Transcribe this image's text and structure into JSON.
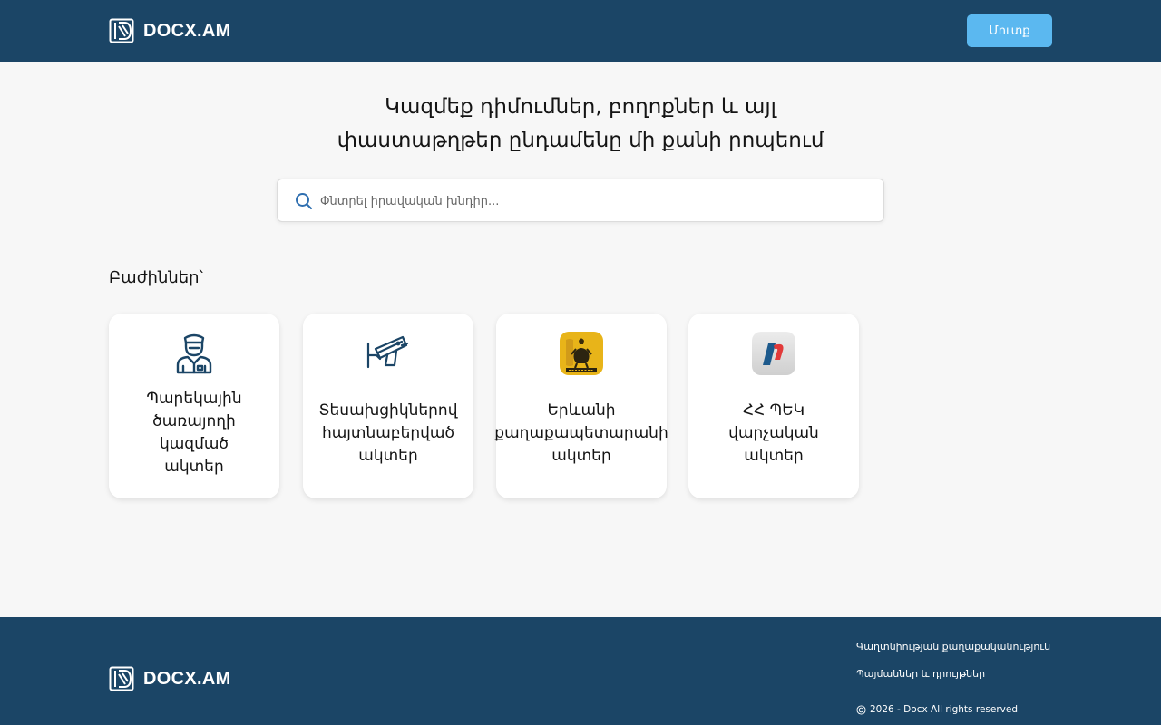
{
  "header": {
    "logo_text": "DOCX.AM",
    "login_label": "Մուտք"
  },
  "hero": {
    "title_line1": "Կազմեք դիմումներ, բողոքներ և այլ",
    "title_line2": "փաստաթղթեր ընդամենը մի քանի րոպեում"
  },
  "search": {
    "placeholder": "Փնտրել իրավական խնդիր...",
    "value": ""
  },
  "sections": {
    "title": "Բաժիններ՝",
    "cards": [
      {
        "label": "Պարեկային ծառայողի կազմած ակտեր",
        "icon": "police-officer-icon"
      },
      {
        "label": "Տեսախցիկներով հայտնաբերված ակտեր",
        "icon": "security-camera-icon"
      },
      {
        "label": "Երևանի քաղաքապետարանի ակտեր",
        "icon": "yerevan-coat-of-arms-icon"
      },
      {
        "label": "ՀՀ ՊԵԿ վարչական ակտեր",
        "icon": "src-logo-icon"
      }
    ]
  },
  "footer": {
    "logo_text": "DOCX.AM",
    "privacy_label": "Գաղտնիության քաղաքականություն",
    "terms_label": "Պայմաններ և դրույթներ",
    "copyright": "2026 - Docx All rights reserved"
  },
  "colors": {
    "primary": "#1b4566",
    "accent": "#5bb8f0",
    "background": "#f7f7f7"
  }
}
